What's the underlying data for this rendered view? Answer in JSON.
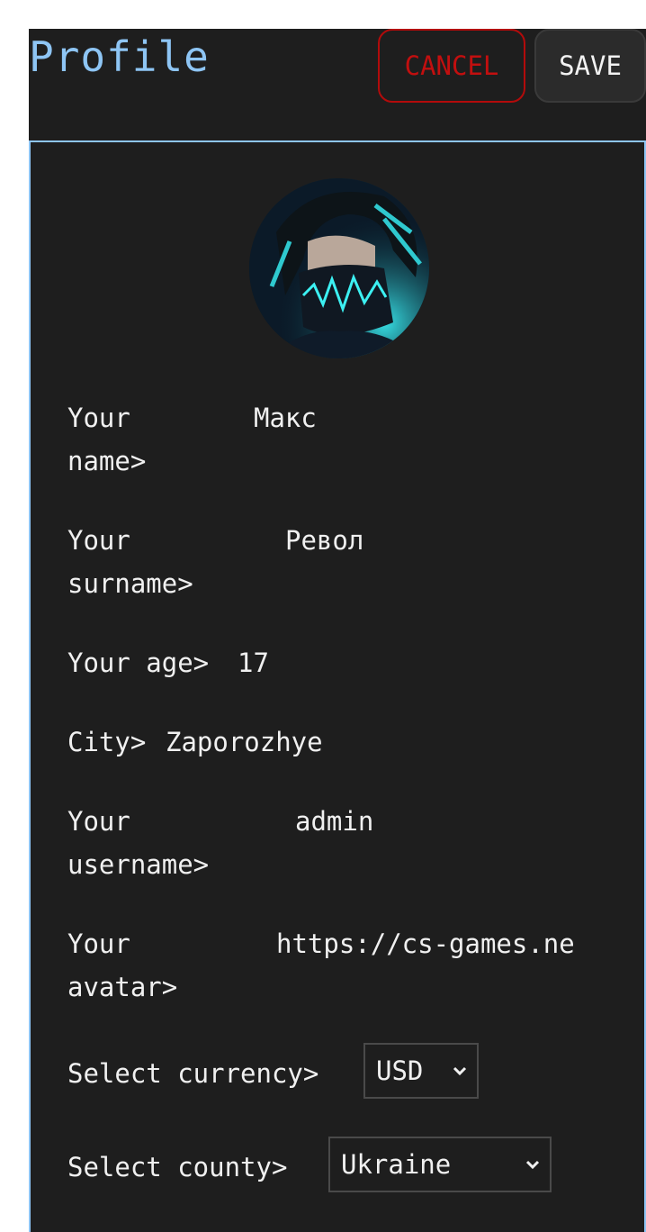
{
  "header": {
    "title": "Profile",
    "cancel_label": "CANCEL",
    "save_label": "SAVE"
  },
  "colors": {
    "title": "#8ec5f4",
    "panel_border": "#8ec5f4",
    "cancel": "#c20f0f",
    "background": "#1e1e1e"
  },
  "avatar": {
    "icon": "avatar-image"
  },
  "fields": {
    "name": {
      "label_line1": "Your",
      "label_line2": "name>",
      "value": "Макс"
    },
    "surname": {
      "label_line1": "Your",
      "label_line2": "surname>",
      "value": "Револ"
    },
    "age": {
      "label": "Your age>",
      "value": "17"
    },
    "city": {
      "label": "City>",
      "value": "Zaporozhye"
    },
    "username": {
      "label_line1": "Your",
      "label_line2": "username>",
      "value": "admin"
    },
    "avatar_url": {
      "label_line1": "Your",
      "label_line2": "avatar>",
      "value": "https://cs-games.ne"
    },
    "currency": {
      "label": "Select currency>",
      "selected": "USD"
    },
    "country": {
      "label": "Select county>",
      "selected": "Ukraine"
    }
  }
}
